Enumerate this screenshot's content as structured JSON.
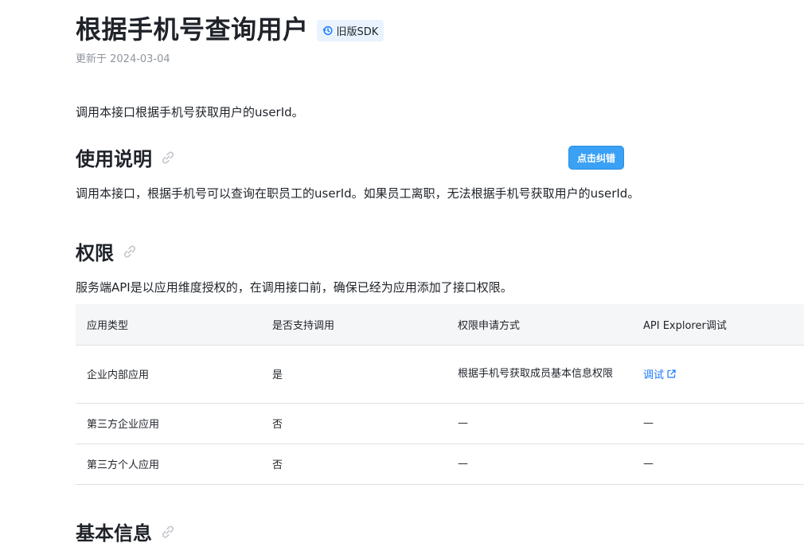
{
  "header": {
    "title": "根据手机号查询用户",
    "badge": "旧版SDK",
    "updated": "更新于 2024-03-04"
  },
  "intro": "调用本接口根据手机号获取用户的userId。",
  "usage": {
    "heading": "使用说明",
    "feedback_button": "点击纠错",
    "text": "调用本接口，根据手机号可以查询在职员工的userId。如果员工离职，无法根据手机号获取用户的userId。"
  },
  "permission": {
    "heading": "权限",
    "text": "服务端API是以应用维度授权的，在调用接口前，确保已经为应用添加了接口权限。",
    "table": {
      "headers": [
        "应用类型",
        "是否支持调用",
        "权限申请方式",
        "API Explorer调试"
      ],
      "rows": [
        [
          "企业内部应用",
          "是",
          "根据手机号获取成员基本信息权限",
          "调试"
        ],
        [
          "第三方企业应用",
          "否",
          "—",
          "—"
        ],
        [
          "第三方个人应用",
          "否",
          "—",
          "—"
        ]
      ]
    }
  },
  "basic": {
    "heading": "基本信息"
  },
  "icons": {
    "badge": "history-icon",
    "heading_link": "link-icon",
    "external": "external-link-icon"
  },
  "colors": {
    "accent": "#1677ff",
    "button": "#3aa1f5",
    "badge_bg": "#e8f3ff"
  }
}
